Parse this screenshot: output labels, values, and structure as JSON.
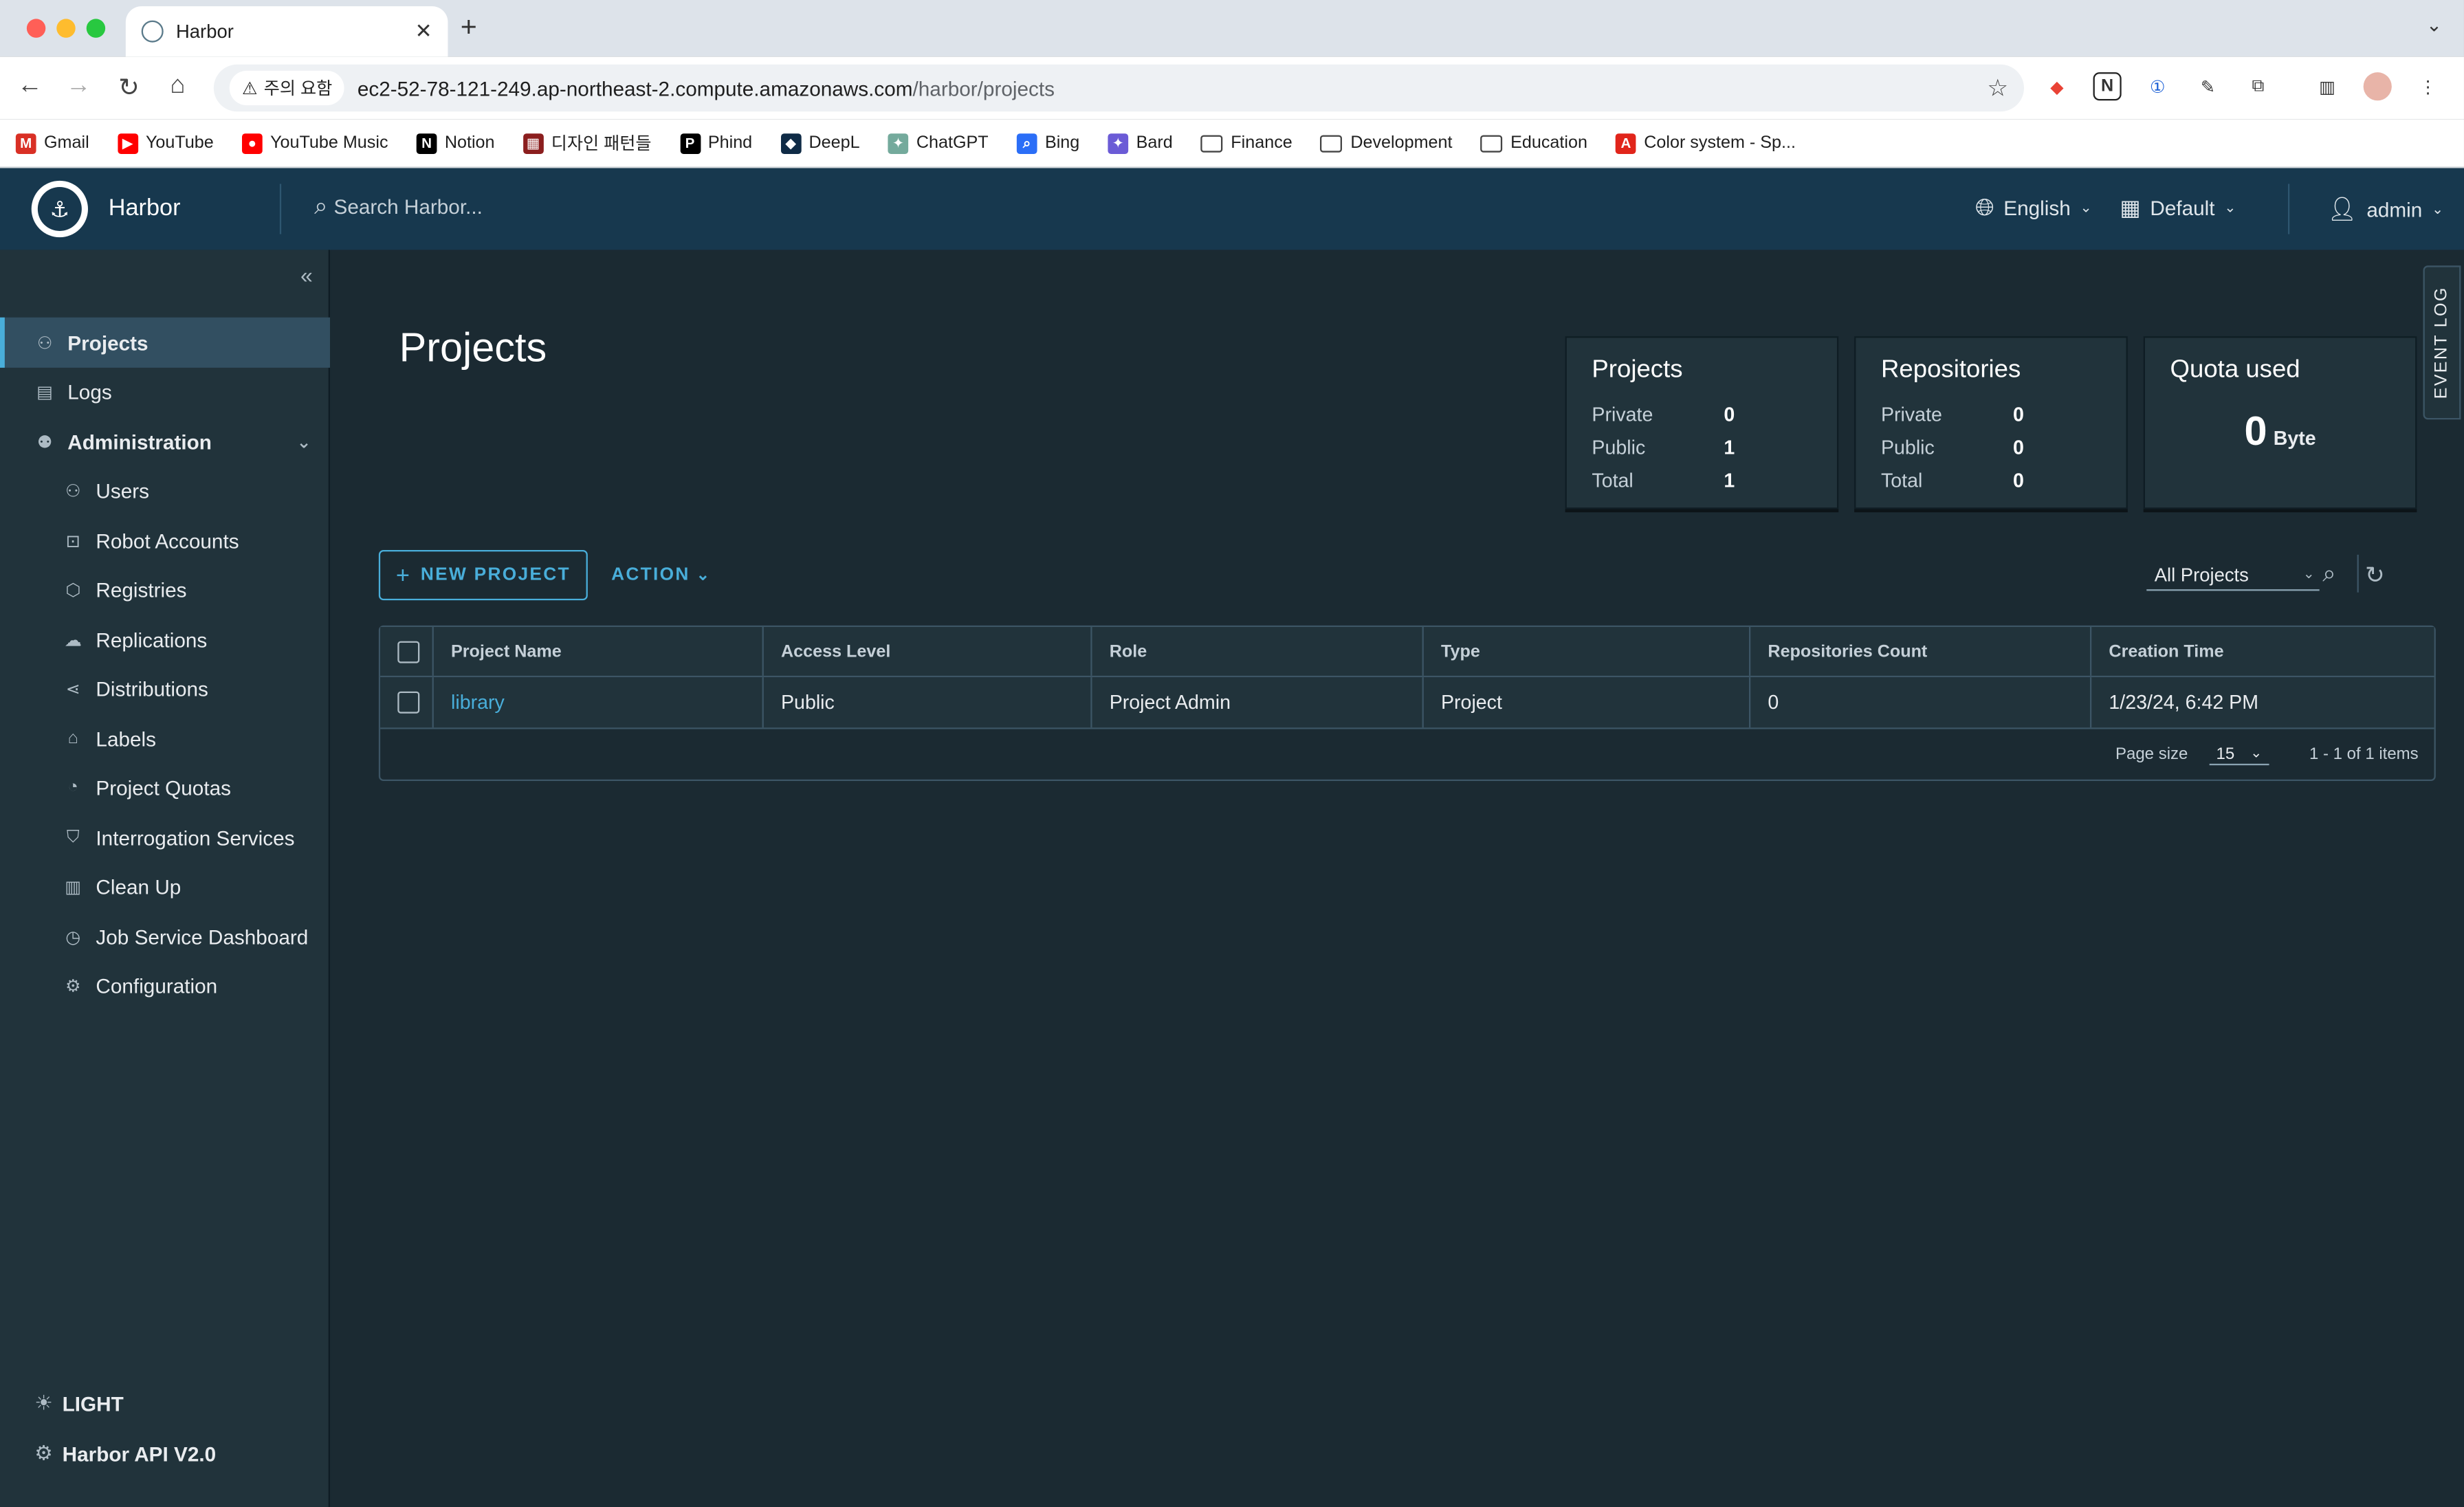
{
  "browser": {
    "tab_title": "Harbor",
    "security_label": "주의 요함",
    "url_host": "ec2-52-78-121-249.ap-northeast-2.compute.amazonaws.com",
    "url_path": "/harbor/projects",
    "bookmarks": [
      {
        "label": "Gmail",
        "color": "#d93025",
        "glyph": "M"
      },
      {
        "label": "YouTube",
        "color": "#ff0000",
        "glyph": "▶"
      },
      {
        "label": "YouTube Music",
        "color": "#ff0000",
        "glyph": "●"
      },
      {
        "label": "Notion",
        "color": "#000000",
        "glyph": "N"
      },
      {
        "label": "디자인 패턴들",
        "color": "#8b1e1e",
        "glyph": "▦"
      },
      {
        "label": "Phind",
        "color": "#000000",
        "glyph": "P"
      },
      {
        "label": "DeepL",
        "color": "#0f2b46",
        "glyph": "◆"
      },
      {
        "label": "ChatGPT",
        "color": "#74aa9c",
        "glyph": "✦"
      },
      {
        "label": "Bing",
        "color": "#2b6ef7",
        "glyph": "⌕"
      },
      {
        "label": "Bard",
        "color": "#6b5bd6",
        "glyph": "✦"
      },
      {
        "label": "Finance",
        "folder": true
      },
      {
        "label": "Development",
        "folder": true
      },
      {
        "label": "Education",
        "folder": true
      },
      {
        "label": "Color system - Sp...",
        "color": "#e1251b",
        "glyph": "A"
      }
    ]
  },
  "header": {
    "brand": "Harbor",
    "search_placeholder": "Search Harbor...",
    "language": "English",
    "theme": "Default",
    "user": "admin"
  },
  "sidebar": {
    "items": [
      {
        "label": "Projects",
        "icon": "projects-icon",
        "active": true
      },
      {
        "label": "Logs",
        "icon": "logs-icon"
      },
      {
        "label": "Administration",
        "icon": "administration-icon",
        "section": true
      },
      {
        "label": "Users",
        "icon": "users-icon"
      },
      {
        "label": "Robot Accounts",
        "icon": "robot-icon"
      },
      {
        "label": "Registries",
        "icon": "registries-icon"
      },
      {
        "label": "Replications",
        "icon": "replications-icon"
      },
      {
        "label": "Distributions",
        "icon": "distributions-icon"
      },
      {
        "label": "Labels",
        "icon": "labels-icon"
      },
      {
        "label": "Project Quotas",
        "icon": "quotas-icon"
      },
      {
        "label": "Interrogation Services",
        "icon": "interrogation-icon"
      },
      {
        "label": "Clean Up",
        "icon": "cleanup-icon"
      },
      {
        "label": "Job Service Dashboard",
        "icon": "job-service-icon"
      },
      {
        "label": "Configuration",
        "icon": "configuration-icon"
      }
    ],
    "theme_toggle": "LIGHT",
    "api_link": "Harbor API V2.0"
  },
  "main": {
    "title": "Projects",
    "event_log": "EVENT LOG",
    "cards": {
      "projects": {
        "title": "Projects",
        "private_label": "Private",
        "private": "0",
        "public_label": "Public",
        "public": "1",
        "total_label": "Total",
        "total": "1"
      },
      "repositories": {
        "title": "Repositories",
        "private_label": "Private",
        "private": "0",
        "public_label": "Public",
        "public": "0",
        "total_label": "Total",
        "total": "0"
      },
      "quota": {
        "title": "Quota used",
        "value": "0",
        "unit": "Byte"
      }
    },
    "new_project_label": "NEW PROJECT",
    "action_label": "ACTION",
    "filter_value": "All Projects",
    "table": {
      "headers": [
        "Project Name",
        "Access Level",
        "Role",
        "Type",
        "Repositories Count",
        "Creation Time"
      ],
      "rows": [
        [
          "library",
          "Public",
          "Project Admin",
          "Project",
          "0",
          "1/23/24, 6:42 PM"
        ]
      ],
      "page_size_label": "Page size",
      "page_size": "15",
      "pagination": "1 - 1 of 1 items"
    }
  }
}
